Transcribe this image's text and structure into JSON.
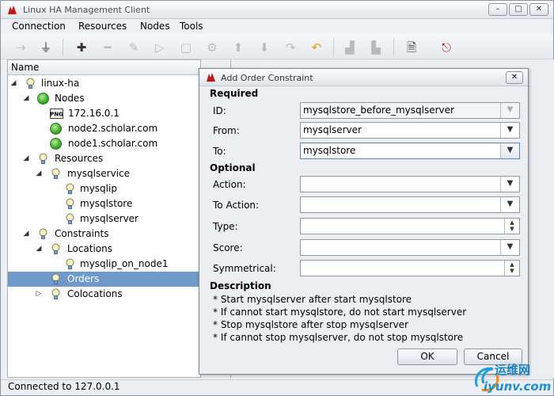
{
  "app": {
    "title": "Linux HA Management Client"
  },
  "menu": [
    "Connection",
    "Resources",
    "Nodes",
    "Tools"
  ],
  "tree": {
    "header": "Name",
    "rows": [
      {
        "label": "linux-ha"
      },
      {
        "label": "Nodes"
      },
      {
        "label": "172.16.0.1"
      },
      {
        "label": "node2.scholar.com"
      },
      {
        "label": "node1.scholar.com"
      },
      {
        "label": "Resources"
      },
      {
        "label": "mysqlservice"
      },
      {
        "label": "mysqlip"
      },
      {
        "label": "mysqlstore"
      },
      {
        "label": "mysqlserver"
      },
      {
        "label": "Constraints"
      },
      {
        "label": "Locations"
      },
      {
        "label": "mysqlip_on_node1"
      },
      {
        "label": "Orders"
      },
      {
        "label": "Colocations"
      }
    ]
  },
  "dialog": {
    "title": "Add Order Constraint",
    "required_label": "Required",
    "optional_label": "Optional",
    "description_label": "Description",
    "fields": {
      "id": {
        "label": "ID:",
        "value": "mysqlstore_before_mysqlserver"
      },
      "from": {
        "label": "From:",
        "value": "mysqlserver"
      },
      "to": {
        "label": "To:",
        "value": "mysqlstore"
      },
      "action": {
        "label": "Action:",
        "value": ""
      },
      "to_action": {
        "label": "To Action:",
        "value": ""
      },
      "type": {
        "label": "Type:",
        "value": ""
      },
      "score": {
        "label": "Score:",
        "value": ""
      },
      "symmetrical": {
        "label": "Symmetrical:",
        "value": ""
      }
    },
    "description": [
      "* Start mysqlserver after start mysqlstore",
      "* If cannot start mysqlstore, do not start mysqlserver",
      "* Stop mysqlstore after stop mysqlserver",
      "* If cannot stop mysqlserver, do not stop mysqlstore"
    ],
    "ok_label": "OK",
    "cancel_label": "Cancel"
  },
  "status": {
    "text": "Connected to 127.0.0.1"
  },
  "watermark": {
    "line1": "运维网",
    "line2": "iyunv.com"
  }
}
